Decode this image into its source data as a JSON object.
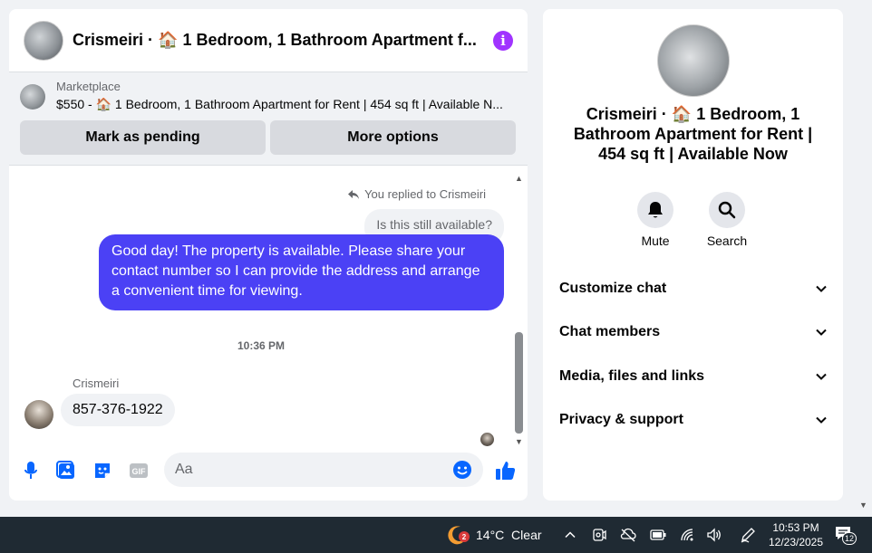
{
  "chat": {
    "title": "Crismeiri · 🏠 1 Bedroom, 1 Bathroom Apartment f...",
    "marketplace": {
      "label": "Marketplace",
      "listing": "$550 - 🏠 1 Bedroom, 1 Bathroom Apartment for Rent | 454 sq ft | Available N...",
      "pending_label": "Mark as pending",
      "more_label": "More options"
    },
    "reply_note": "You replied to Crismeiri",
    "quoted_message": "Is this still available?",
    "outgoing_message": "Good day! The property is available. Please share your contact number so I can provide the address and arrange a convenient time for viewing.",
    "timestamp": "10:36 PM",
    "sender_name": "Crismeiri",
    "incoming_message": "857-376-1922",
    "composer": {
      "placeholder": "Aa"
    },
    "colors": {
      "accent": "#4b41f5",
      "info": "#a033ff",
      "icon_blue": "#0866ff"
    }
  },
  "info": {
    "title": "Crismeiri · 🏠 1 Bedroom, 1 Bathroom Apartment for Rent | 454 sq ft | Available Now",
    "actions": [
      {
        "label": "Mute",
        "icon": "bell-icon"
      },
      {
        "label": "Search",
        "icon": "search-icon"
      }
    ],
    "sections": [
      "Customize chat",
      "Chat members",
      "Media, files and links",
      "Privacy & support"
    ]
  },
  "taskbar": {
    "weather": "14°C  Clear",
    "weather_badge": "2",
    "time": "10:53 PM",
    "date": "12/23/2025",
    "notifications": "12"
  }
}
